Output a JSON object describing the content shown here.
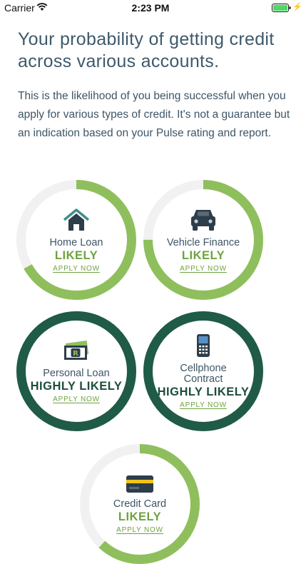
{
  "status_bar": {
    "carrier": "Carrier",
    "time": "2:23 PM"
  },
  "headline": "Your probability of getting credit across various accounts.",
  "intro": "This is the likelihood of you being successful when you apply for various types of credit. It's not a guarantee but an indication based on your Pulse rating and report.",
  "colors": {
    "likely": "#8fbf5d",
    "highly_likely": "#1f5b46",
    "track": "#f1f1f1"
  },
  "accounts": [
    {
      "label": "Home Loan",
      "status": "LIKELY",
      "apply": "APPLY NOW",
      "icon": "house-icon",
      "fill": 0.67
    },
    {
      "label": "Vehicle Finance",
      "status": "LIKELY",
      "apply": "APPLY NOW",
      "icon": "car-icon",
      "fill": 0.75
    },
    {
      "label": "Personal Loan",
      "status": "HIGHLY LIKELY",
      "apply": "APPLY NOW",
      "icon": "banknote-icon",
      "fill": 1.0
    },
    {
      "label": "Cellphone Contract",
      "label_lines": [
        "Cellphone",
        "Contract"
      ],
      "status": "HIGHLY LIKELY",
      "apply": "APPLY NOW",
      "icon": "cellphone-icon",
      "fill": 1.0
    },
    {
      "label": "Credit Card",
      "status": "LIKELY",
      "apply": "APPLY NOW",
      "icon": "credit-card-icon",
      "fill": 0.62
    }
  ]
}
